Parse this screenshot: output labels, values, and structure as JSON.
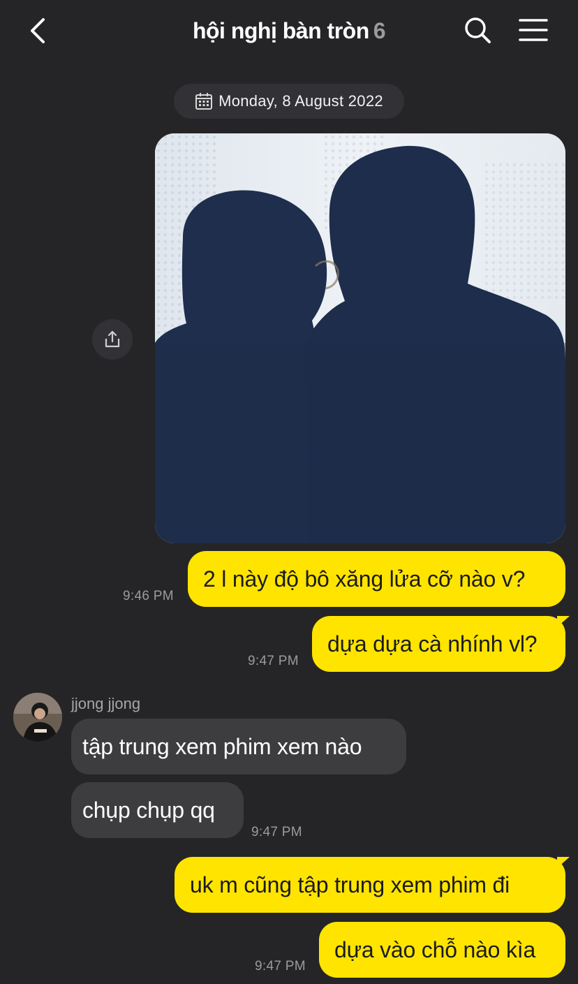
{
  "header": {
    "title": "hội nghị bàn tròn",
    "member_count": "6",
    "back_icon": "chevron-left-icon",
    "search_icon": "search-icon",
    "menu_icon": "hamburger-menu-icon"
  },
  "date_divider": {
    "label": "Monday, 8 August 2022",
    "icon": "calendar-icon"
  },
  "shared_photo": {
    "share_icon": "share-icon"
  },
  "messages": [
    {
      "text": "2 l này độ bô xăng lửa cỡ nào v?",
      "time": "9:46 PM",
      "from": "me"
    },
    {
      "text": "dựa dựa cà nhính vl?",
      "time": "9:47 PM",
      "from": "me"
    },
    {
      "text": "tập trung xem phim xem nào",
      "time": "",
      "from": "jjong jjong"
    },
    {
      "text": "chụp chụp qq",
      "time": "9:47 PM",
      "from": "jjong jjong"
    },
    {
      "text": "uk m cũng tập trung xem phim đi",
      "time": "",
      "from": "me"
    },
    {
      "text": "dựa vào chỗ nào kìa",
      "time": "9:47 PM",
      "from": "me"
    }
  ],
  "sender": {
    "name": "jjong jjong"
  },
  "colors": {
    "background": "#252527",
    "my_bubble": "#ffe400",
    "their_bubble": "#3d3d40",
    "muted_text": "#9b9b9e"
  }
}
